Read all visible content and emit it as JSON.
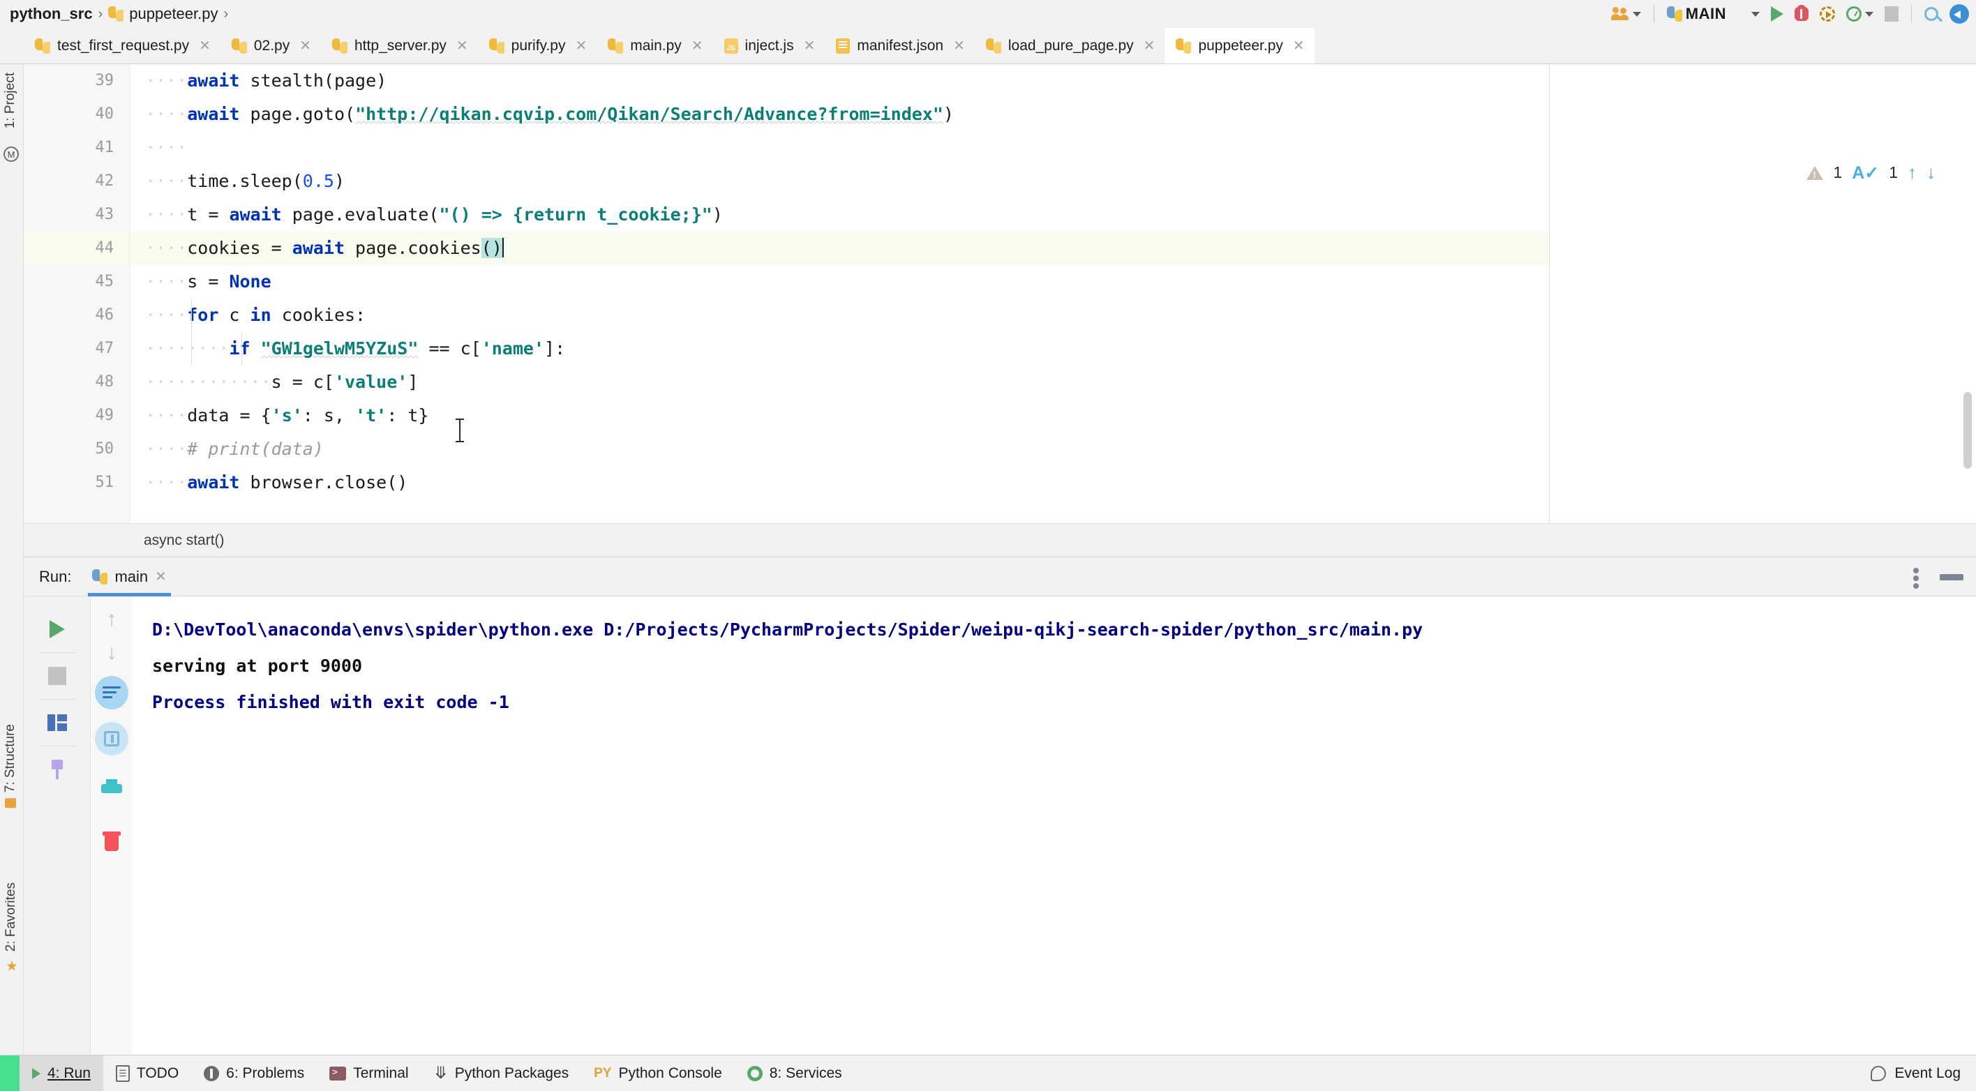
{
  "breadcrumb": {
    "items": [
      "python_src",
      "puppeteer.py"
    ],
    "separator": "›"
  },
  "toolbar": {
    "run_config": "MAIN",
    "icons": [
      "people-icon",
      "python-icon",
      "run-icon",
      "debug-icon",
      "coverage-icon",
      "profile-icon",
      "stop-icon",
      "search-icon",
      "updates-icon"
    ]
  },
  "tabs": [
    {
      "label": "test_first_request.py",
      "icon": "python-file-icon",
      "active": false
    },
    {
      "label": "02.py",
      "icon": "python-file-icon",
      "active": false
    },
    {
      "label": "http_server.py",
      "icon": "python-file-icon",
      "active": false
    },
    {
      "label": "purify.py",
      "icon": "python-file-icon",
      "active": false
    },
    {
      "label": "main.py",
      "icon": "python-file-icon",
      "active": false
    },
    {
      "label": "inject.js",
      "icon": "javascript-file-icon",
      "active": false
    },
    {
      "label": "manifest.json",
      "icon": "json-file-icon",
      "active": false
    },
    {
      "label": "load_pure_page.py",
      "icon": "python-file-icon",
      "active": false
    },
    {
      "label": "puppeteer.py",
      "icon": "python-file-icon",
      "active": true
    }
  ],
  "tab_close_glyph": "✕",
  "left_tool_tabs": [
    {
      "label": "1: Project",
      "shortcut": "1"
    },
    {
      "label": "7: Structure",
      "shortcut": "7"
    },
    {
      "label": "2: Favorites",
      "shortcut": "2"
    }
  ],
  "editor": {
    "first_line": 39,
    "current_line": 44,
    "line_numbers": [
      "39",
      "40",
      "41",
      "42",
      "43",
      "44",
      "45",
      "46",
      "47",
      "48",
      "49",
      "50",
      "51"
    ],
    "lines": [
      {
        "n": "39",
        "text": "    await stealth(page)"
      },
      {
        "n": "40",
        "text": "    await page.goto(\"http://qikan.cqvip.com/Qikan/Search/Advance?from=index\")"
      },
      {
        "n": "41",
        "text": ""
      },
      {
        "n": "42",
        "text": "    time.sleep(0.5)"
      },
      {
        "n": "43",
        "text": "    t = await page.evaluate(\"() => {return t_cookie;}\")"
      },
      {
        "n": "44",
        "text": "    cookies = await page.cookies()"
      },
      {
        "n": "45",
        "text": "    s = None"
      },
      {
        "n": "46",
        "text": "    for c in cookies:"
      },
      {
        "n": "47",
        "text": "        if \"GW1gelwM5YZuS\" == c['name']:"
      },
      {
        "n": "48",
        "text": "            s = c['value']"
      },
      {
        "n": "49",
        "text": "    data = {'s': s, 't': t}"
      },
      {
        "n": "50",
        "text": "    # print(data)"
      },
      {
        "n": "51",
        "text": "    await browser.close()"
      }
    ],
    "breadcrumb_footer": "async start()",
    "inspections": {
      "warning_count": "1",
      "spelling_count": "1",
      "up_glyph": "↑",
      "down_glyph": "↓"
    }
  },
  "run_panel": {
    "label": "Run:",
    "tab_name": "main",
    "tab_icon": "python-icon",
    "close_glyph": "✕",
    "output": [
      {
        "text": "D:\\DevTool\\anaconda\\envs\\spider\\python.exe D:/Projects/PycharmProjects/Spider/weipu-qikj-search-spider/python_src/main.py",
        "style": "link"
      },
      {
        "text": "serving at port 9000",
        "style": "plain"
      },
      {
        "text": "",
        "style": "plain"
      },
      {
        "text": "Process finished with exit code -1",
        "style": "link"
      }
    ],
    "tools": [
      "rerun-icon",
      "stop-icon",
      "layout-icon",
      "pin-icon"
    ],
    "tools2": [
      "up-arrow-icon",
      "down-arrow-icon",
      "soft-wrap-icon",
      "scroll-to-end-icon",
      "print-icon",
      "clear-all-icon"
    ],
    "header_buttons": [
      "more-options-icon",
      "hide-icon"
    ]
  },
  "status_bar": {
    "items": [
      {
        "label": "4: Run",
        "underline": "4",
        "icon": "run-icon",
        "active": true
      },
      {
        "label": "TODO",
        "underline": "",
        "icon": "todo-icon",
        "active": false
      },
      {
        "label": "6: Problems",
        "underline": "6",
        "icon": "problems-icon",
        "active": false
      },
      {
        "label": "Terminal",
        "underline": "",
        "icon": "terminal-icon",
        "active": false
      },
      {
        "label": "Python Packages",
        "underline": "",
        "icon": "packages-icon",
        "active": false
      },
      {
        "label": "Python Console",
        "underline": "",
        "icon": "python-console-icon",
        "active": false
      },
      {
        "label": "8: Services",
        "underline": "8",
        "icon": "services-icon",
        "active": false
      }
    ],
    "event_log": "Event Log"
  },
  "colors": {
    "accent_blue": "#4a90d9",
    "keyword": "#0033b3",
    "string": "#0a7e77",
    "number": "#1750eb",
    "comment": "#9a9a9a",
    "console_link": "#000080",
    "status_green": "#46e08e",
    "run_green": "#59a869"
  }
}
